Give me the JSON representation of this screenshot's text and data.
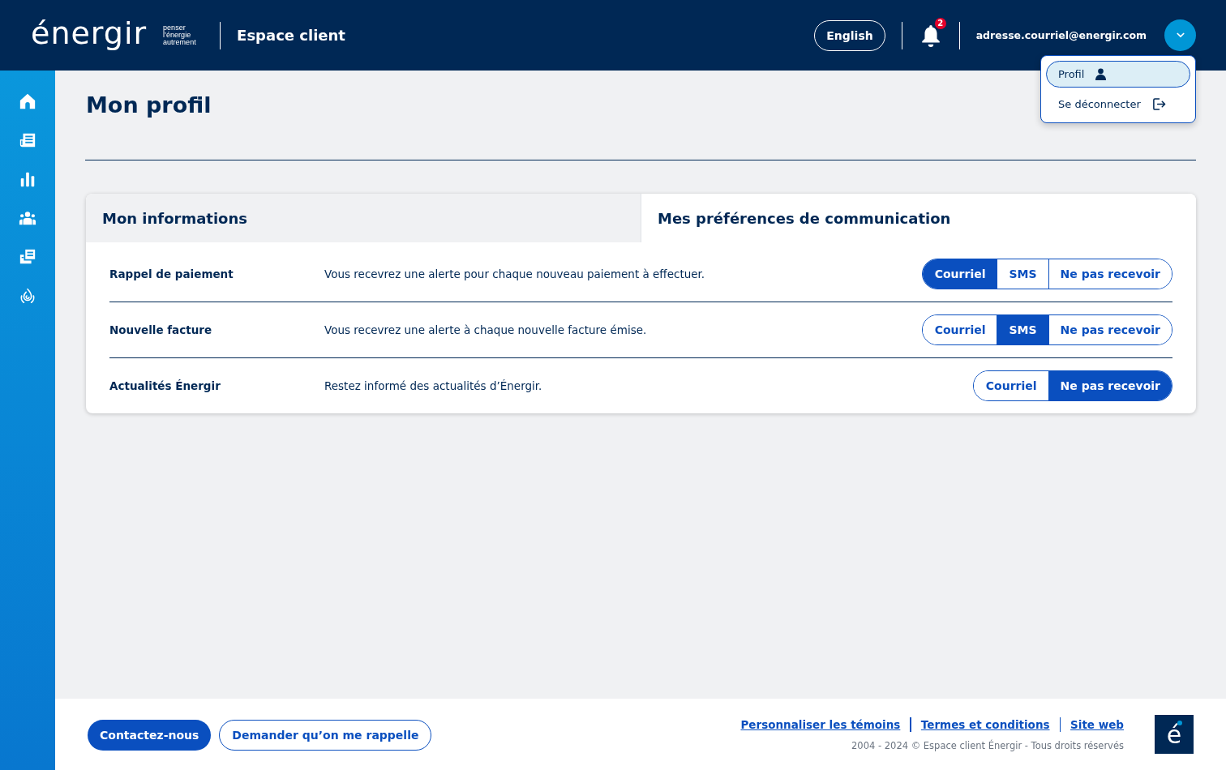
{
  "header": {
    "logo": "énergir",
    "tagline": "penser l’énergie autrement",
    "app_title": "Espace client",
    "language_button": "English",
    "notification_count": "2",
    "user_email": "adresse.courriel@energir.com",
    "menu_expanded": true
  },
  "user_menu": [
    {
      "label": "Profil",
      "kind": "profile",
      "selected": true
    },
    {
      "label": "Se déconnecter",
      "kind": "logout",
      "selected": false
    }
  ],
  "sidebar": {
    "items": [
      {
        "kind": "home"
      },
      {
        "kind": "bill"
      },
      {
        "kind": "chart"
      },
      {
        "kind": "people"
      },
      {
        "kind": "documents"
      },
      {
        "kind": "flame"
      }
    ]
  },
  "page_title": "Mon profil",
  "tabs": [
    {
      "label": "Mon informations",
      "selected": false
    },
    {
      "label": "Mes préférences de communication",
      "selected": true
    }
  ],
  "preferences": [
    {
      "name": "Rappel de paiement",
      "description": "Vous recevrez une alerte pour chaque nouveau paiement à effectuer.",
      "options": [
        {
          "label": "Courriel",
          "selected": true
        },
        {
          "label": "SMS",
          "selected": false
        },
        {
          "label": "Ne pas recevoir",
          "selected": false
        }
      ]
    },
    {
      "name": "Nouvelle facture",
      "description": "Vous recevrez une alerte à chaque nouvelle facture émise.",
      "options": [
        {
          "label": "Courriel",
          "selected": false
        },
        {
          "label": "SMS",
          "selected": true
        },
        {
          "label": "Ne pas recevoir",
          "selected": false
        }
      ]
    },
    {
      "name": "Actualités Énergir",
      "description": "Restez informé des actualités d’Énergir.",
      "options": [
        {
          "label": "Courriel",
          "selected": false
        },
        {
          "label": "Ne pas recevoir",
          "selected": true
        }
      ]
    }
  ],
  "footer": {
    "buttons": [
      {
        "label": "Contactez-nous",
        "kind": "primary"
      },
      {
        "label": "Demander qu’on me rappelle",
        "kind": "outline"
      }
    ],
    "links": [
      "Personnaliser les témoins",
      "Termes et conditions",
      "Site web"
    ],
    "copyright": "2004 - 2024 © Espace client Énergir - Tous droits réservés",
    "logo_mark": "é"
  }
}
